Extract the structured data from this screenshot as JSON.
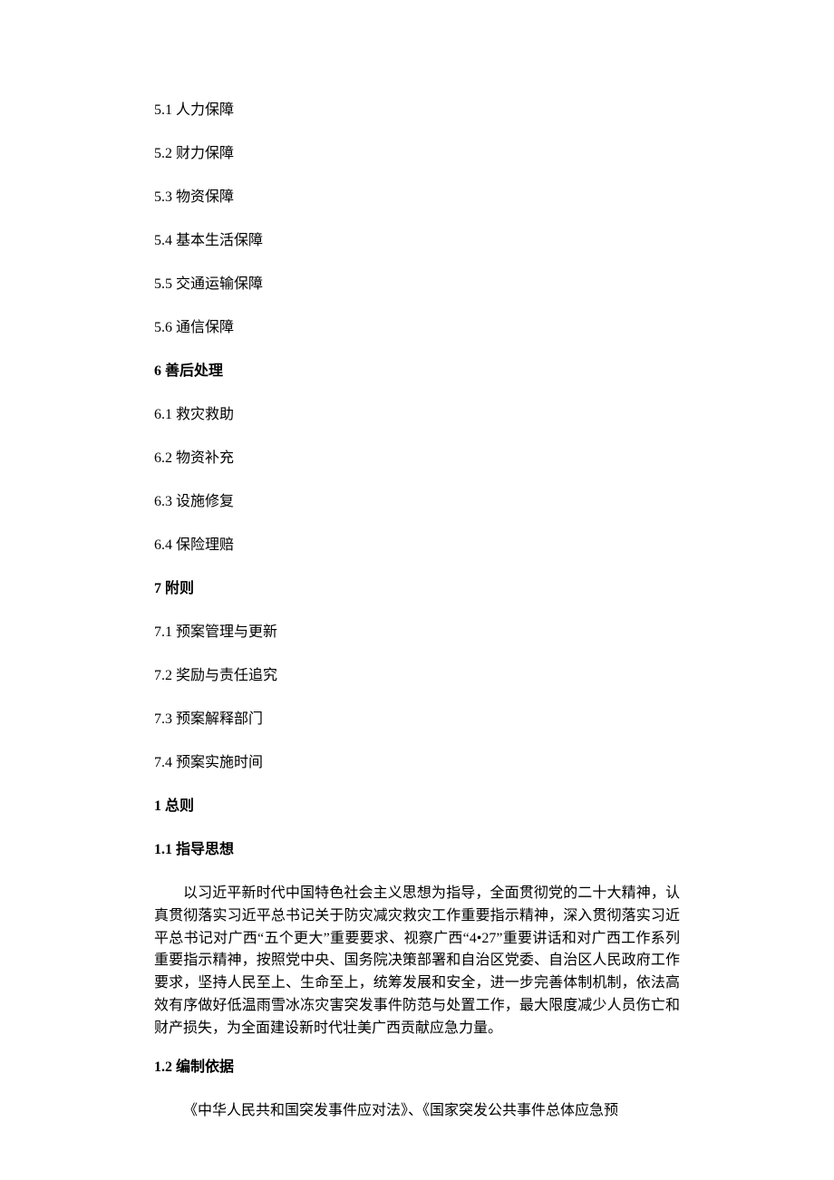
{
  "toc": {
    "s5_1": "5.1 人力保障",
    "s5_2": "5.2 财力保障",
    "s5_3": "5.3 物资保障",
    "s5_4": "5.4 基本生活保障",
    "s5_5": "5.5 交通运输保障",
    "s5_6": "5.6 通信保障",
    "s6": "6 善后处理",
    "s6_1": "6.1 救灾救助",
    "s6_2": "6.2 物资补充",
    "s6_3": "6.3 设施修复",
    "s6_4": "6.4 保险理赔",
    "s7": "7 附则",
    "s7_1": "7.1 预案管理与更新",
    "s7_2": "7.2 奖励与责任追究",
    "s7_3": "7.3 预案解释部门",
    "s7_4": "7.4 预案实施时间"
  },
  "body": {
    "h1": "1 总则",
    "h1_1": "1.1 指导思想",
    "p1_1": "以习近平新时代中国特色社会主义思想为指导，全面贯彻党的二十大精神，认真贯彻落实习近平总书记关于防灾减灾救灾工作重要指示精神，深入贯彻落实习近平总书记对广西“五个更大”重要要求、视察广西“4•27”重要讲话和对广西工作系列重要指示精神，按照党中央、国务院决策部署和自治区党委、自治区人民政府工作要求，坚持人民至上、生命至上，统筹发展和安全，进一步完善体制机制，依法高效有序做好低温雨雪冰冻灾害突发事件防范与处置工作，最大限度减少人员伤亡和财产损失，为全面建设新时代壮美广西贡献应急力量。",
    "h1_2": "1.2 编制依据",
    "p1_2": "《中华人民共和国突发事件应对法》、《国家突发公共事件总体应急预"
  }
}
